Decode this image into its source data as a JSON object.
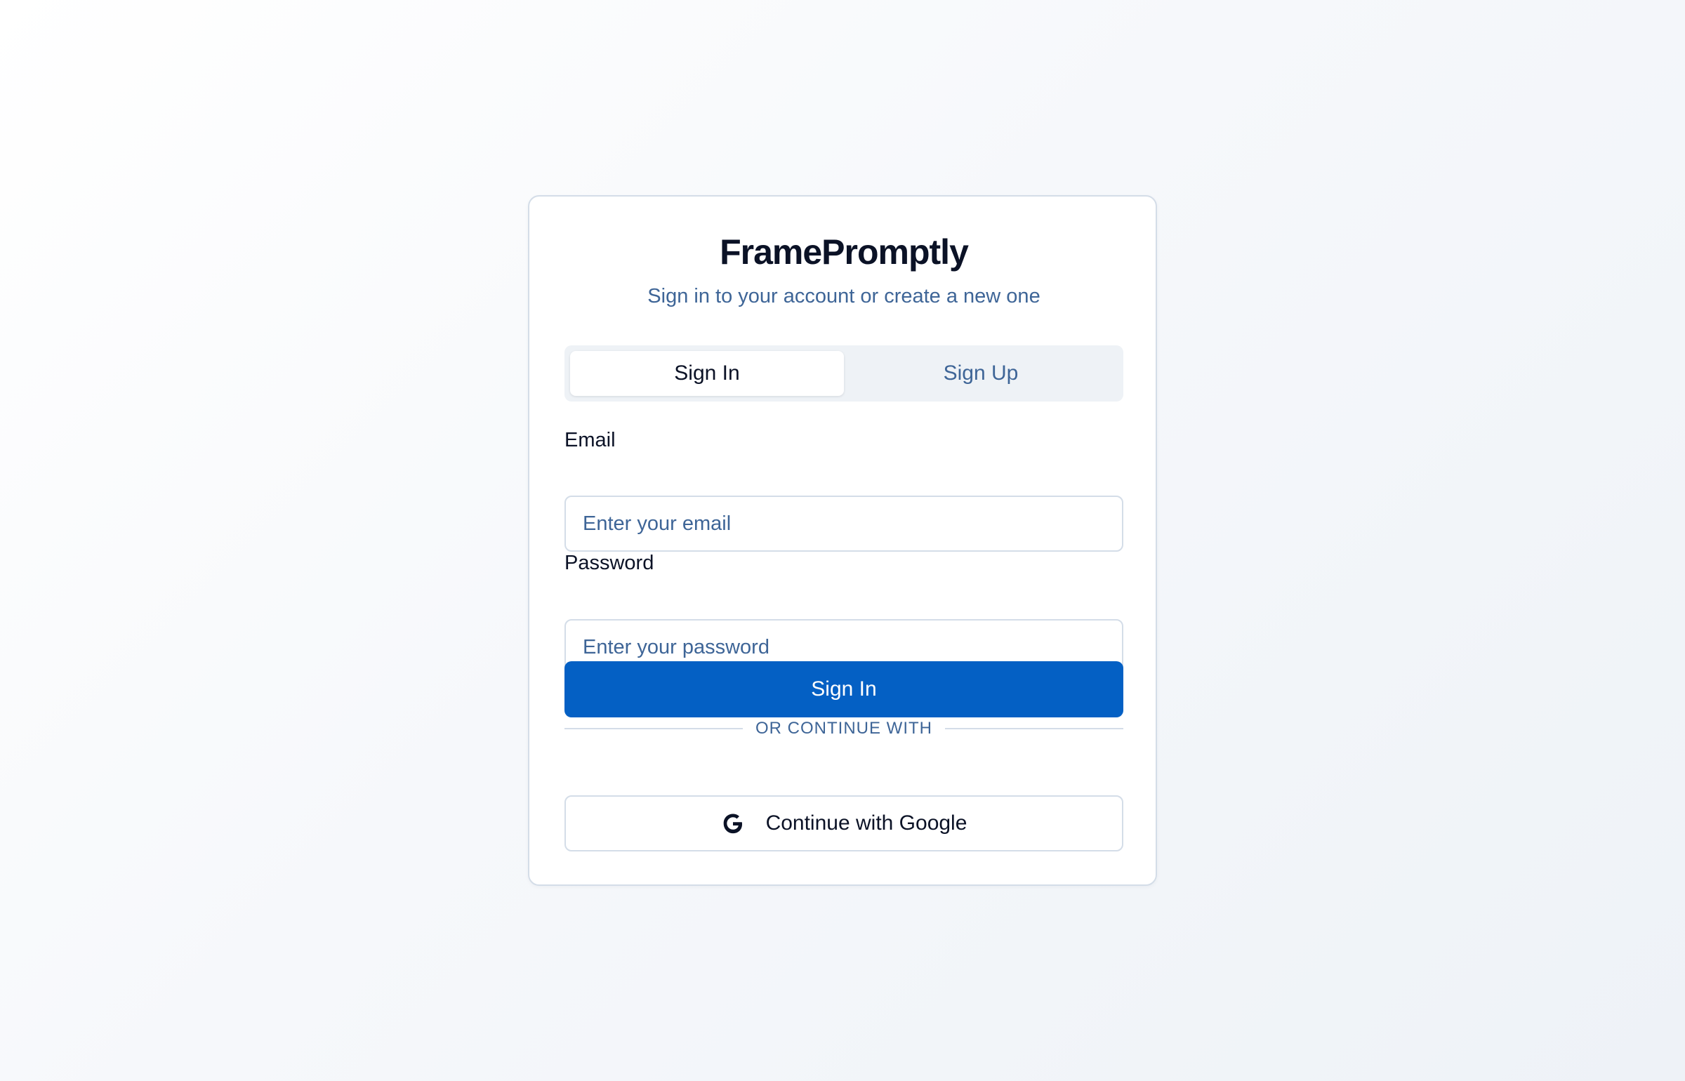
{
  "app": {
    "title": "FramePromptly",
    "subtitle": "Sign in to your account or create a new one"
  },
  "tabs": [
    {
      "label": "Sign In",
      "active": true
    },
    {
      "label": "Sign Up",
      "active": false
    }
  ],
  "form": {
    "email_label": "Email",
    "email_placeholder": "Enter your email",
    "email_value": "",
    "password_label": "Password",
    "password_placeholder": "Enter your password",
    "password_value": "",
    "submit_label": "Sign In"
  },
  "divider": {
    "text": "OR CONTINUE WITH"
  },
  "oauth": {
    "google_label": "Continue with Google",
    "google_icon": "google-icon"
  },
  "colors": {
    "primary": "#0460c4",
    "text": "#0b1226",
    "muted": "#3e6597",
    "border": "#d4dde8"
  }
}
